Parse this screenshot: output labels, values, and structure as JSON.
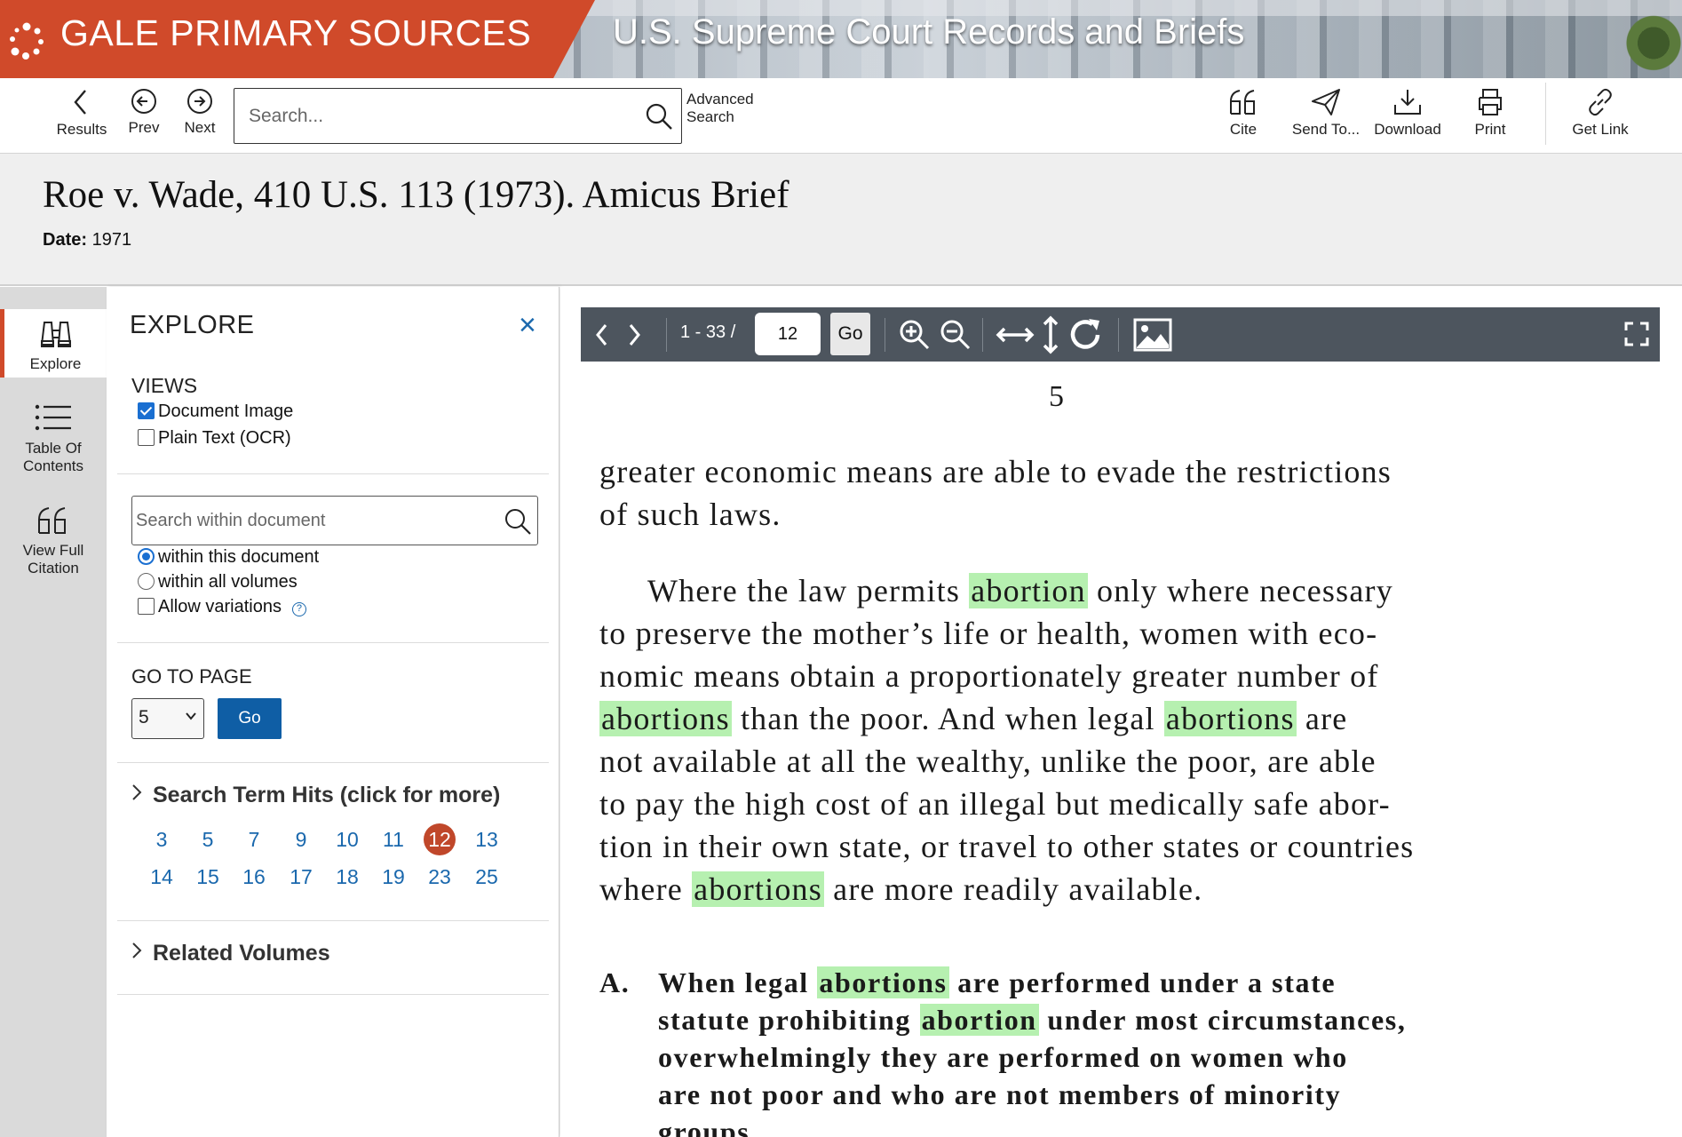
{
  "banner": {
    "brand_name": "GALE PRIMARY SOURCES",
    "collection_title": "U.S. Supreme Court Records and Briefs",
    "brand_color": "#d04a2a"
  },
  "toolbar": {
    "results_label": "Results",
    "prev_label": "Prev",
    "next_label": "Next",
    "search_placeholder": "Search...",
    "advanced_line1": "Advanced",
    "advanced_line2": "Search",
    "cite_label": "Cite",
    "send_label": "Send To...",
    "download_label": "Download",
    "print_label": "Print",
    "getlink_label": "Get Link"
  },
  "document": {
    "title": "Roe v. Wade, 410 U.S. 113 (1973). Amicus Brief",
    "date_label": "Date:",
    "date_value": "1971"
  },
  "rail": {
    "explore_label": "Explore",
    "toc_line1": "Table Of",
    "toc_line2": "Contents",
    "citation_line1": "View Full",
    "citation_line2": "Citation"
  },
  "explore": {
    "title": "EXPLORE",
    "close_glyph": "×",
    "views_label": "VIEWS",
    "view_options": [
      {
        "label": "Document Image",
        "checked": true
      },
      {
        "label": "Plain Text (OCR)",
        "checked": false
      }
    ],
    "within_placeholder": "Search within document",
    "scope_options": [
      {
        "label": "within this document",
        "selected": true
      },
      {
        "label": "within all volumes",
        "selected": false
      }
    ],
    "variations_label": "Allow variations",
    "help_glyph": "?",
    "goto_label": "GO TO PAGE",
    "goto_value": "5",
    "goto_button": "Go",
    "hits_heading": "Search Term Hits (click for more)",
    "hits": [
      "3",
      "5",
      "7",
      "9",
      "10",
      "11",
      "12",
      "13",
      "14",
      "15",
      "16",
      "17",
      "18",
      "19",
      "23",
      "25"
    ],
    "current_hit": "12",
    "related_heading": "Related Volumes"
  },
  "viewer": {
    "range": "1 - 33 /",
    "page_input": "12",
    "go_label": "Go",
    "bar_color": "#4d555e",
    "highlight_color": "#b6f0b0",
    "page_number": "5",
    "para1": [
      "greater economic means are able to evade the restrictions",
      "of such laws."
    ],
    "para2": {
      "l1a": "Where the law permits ",
      "l1h": "abortion",
      "l1b": " only where necessary",
      "l2": "to preserve the mother’s life or health, women with eco-",
      "l3": "nomic means obtain a proportionately greater number of",
      "l4h1": "abortions",
      "l4a": " than the poor.  And when legal ",
      "l4h2": "abortions",
      "l4b": " are",
      "l5": "not available at all the wealthy, unlike the poor, are able",
      "l6": "to pay the high cost of an illegal but medically safe abor-",
      "l7": "tion in their own state, or travel to other states or countries",
      "l8a": "where ",
      "l8h": "abortions",
      "l8b": " are more readily available."
    },
    "section": {
      "marker": "A.",
      "l1a": "When legal ",
      "l1h": "abortions",
      "l1b": " are performed under a state",
      "l2a": "statute prohibiting ",
      "l2h": "abortion",
      "l2b": " under most circumstances,",
      "l3": "overwhelmingly they are performed on women who",
      "l4": "are not poor and who are not members of minority",
      "l5": "groups."
    }
  }
}
